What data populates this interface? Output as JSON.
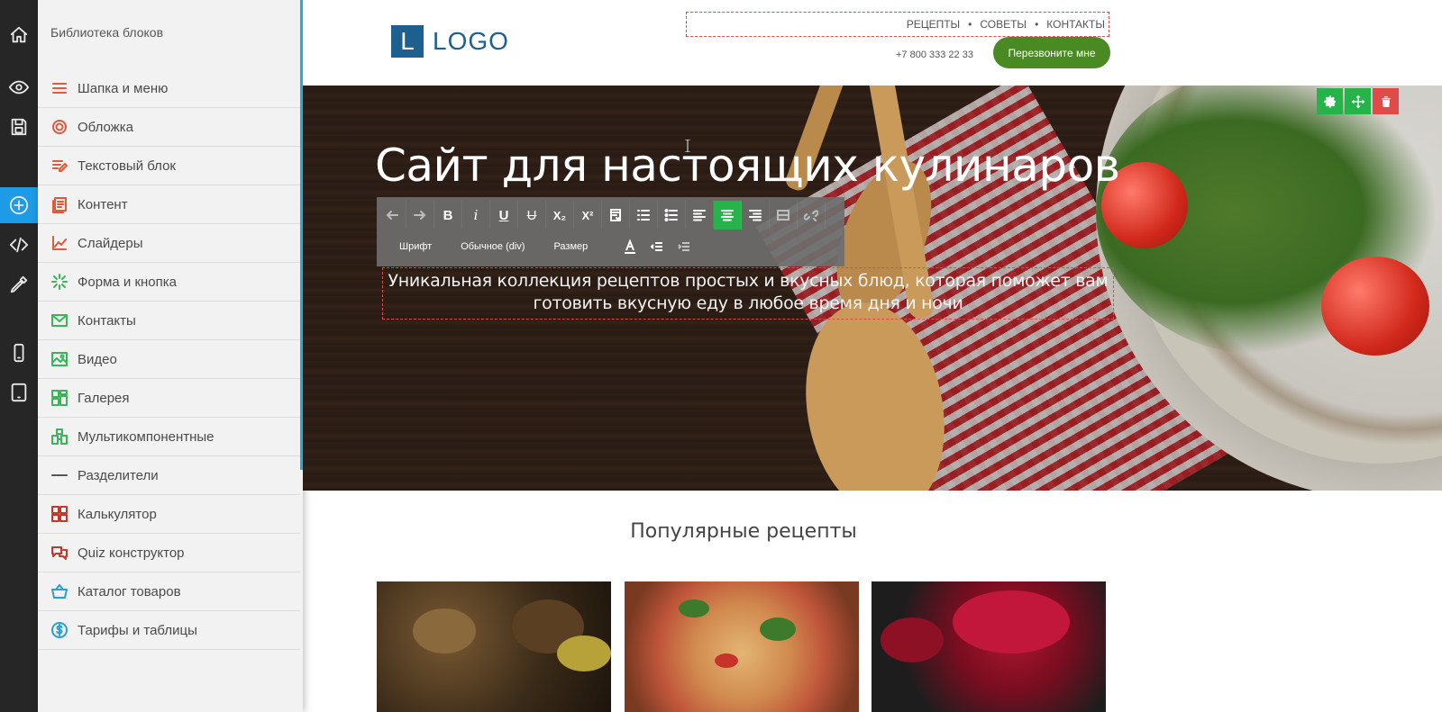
{
  "sidebar": {
    "title": "Библиотека блоков",
    "items": [
      {
        "label": "Шапка и меню",
        "icon": "menu-icon",
        "color": "#e05a3a"
      },
      {
        "label": "Обложка",
        "icon": "target-icon",
        "color": "#e05a3a"
      },
      {
        "label": "Текстовый блок",
        "icon": "text-edit-icon",
        "color": "#e05a3a"
      },
      {
        "label": "Контент",
        "icon": "content-icon",
        "color": "#e05a3a"
      },
      {
        "label": "Слайдеры",
        "icon": "slider-icon",
        "color": "#e05a3a"
      },
      {
        "label": "Форма и кнопка",
        "icon": "click-icon",
        "color": "#3cb55a"
      },
      {
        "label": "Контакты",
        "icon": "envelope-icon",
        "color": "#3cb55a"
      },
      {
        "label": "Видео",
        "icon": "image-icon",
        "color": "#3cb55a"
      },
      {
        "label": "Галерея",
        "icon": "gallery-grid-icon",
        "color": "#3cb55a"
      },
      {
        "label": "Мультикомпонентные",
        "icon": "multicomponent-icon",
        "color": "#3cb55a"
      },
      {
        "label": "Разделители",
        "icon": "divider-icon",
        "color": "#555555"
      },
      {
        "label": "Калькулятор",
        "icon": "calculator-icon",
        "color": "#c0392b"
      },
      {
        "label": "Quiz конструктор",
        "icon": "chat-icon",
        "color": "#c0392b"
      },
      {
        "label": "Каталог товаров",
        "icon": "basket-icon",
        "color": "#2a9fd6"
      },
      {
        "label": "Тарифы и таблицы",
        "icon": "dollar-icon",
        "color": "#2a9fd6"
      }
    ]
  },
  "rail": {
    "buttons": [
      "home-icon",
      "eye-icon",
      "save-icon",
      "add-icon",
      "code-icon",
      "eyedropper-icon",
      "phone-icon",
      "tablet-icon"
    ]
  },
  "header": {
    "logo_letter": "L",
    "logo_text": "LOGO",
    "nav": [
      "РЕЦЕПТЫ",
      "СОВЕТЫ",
      "КОНТАКТЫ"
    ],
    "nav_separator": "•",
    "phone": "+7 800 333 22 33",
    "callback_label": "Перезвоните мне"
  },
  "hero": {
    "title": "Сайт для настоящих кулинаров",
    "subtitle_line1": "Уникальная коллекция рецептов простых и вкусных блюд, которая поможет вам",
    "subtitle_line2": "готовить вкусную еду в любое время дня и ночи"
  },
  "editor_toolbar": {
    "font_label": "Шрифт",
    "format_label": "Обычное (div)",
    "size_label": "Размер",
    "bold_label": "B",
    "italic_label": "i",
    "underline_label": "U",
    "strike_label": "U",
    "subscript_label": "X₂",
    "superscript_label": "X²",
    "active_tool": "align-center",
    "active_color": "#26b34a"
  },
  "popular": {
    "title": "Популярные рецепты"
  },
  "colors": {
    "accent": "#29a9e0",
    "callback_button": "#4a8a22",
    "logo": "#1d5f8f",
    "danger": "#e24a4a"
  }
}
